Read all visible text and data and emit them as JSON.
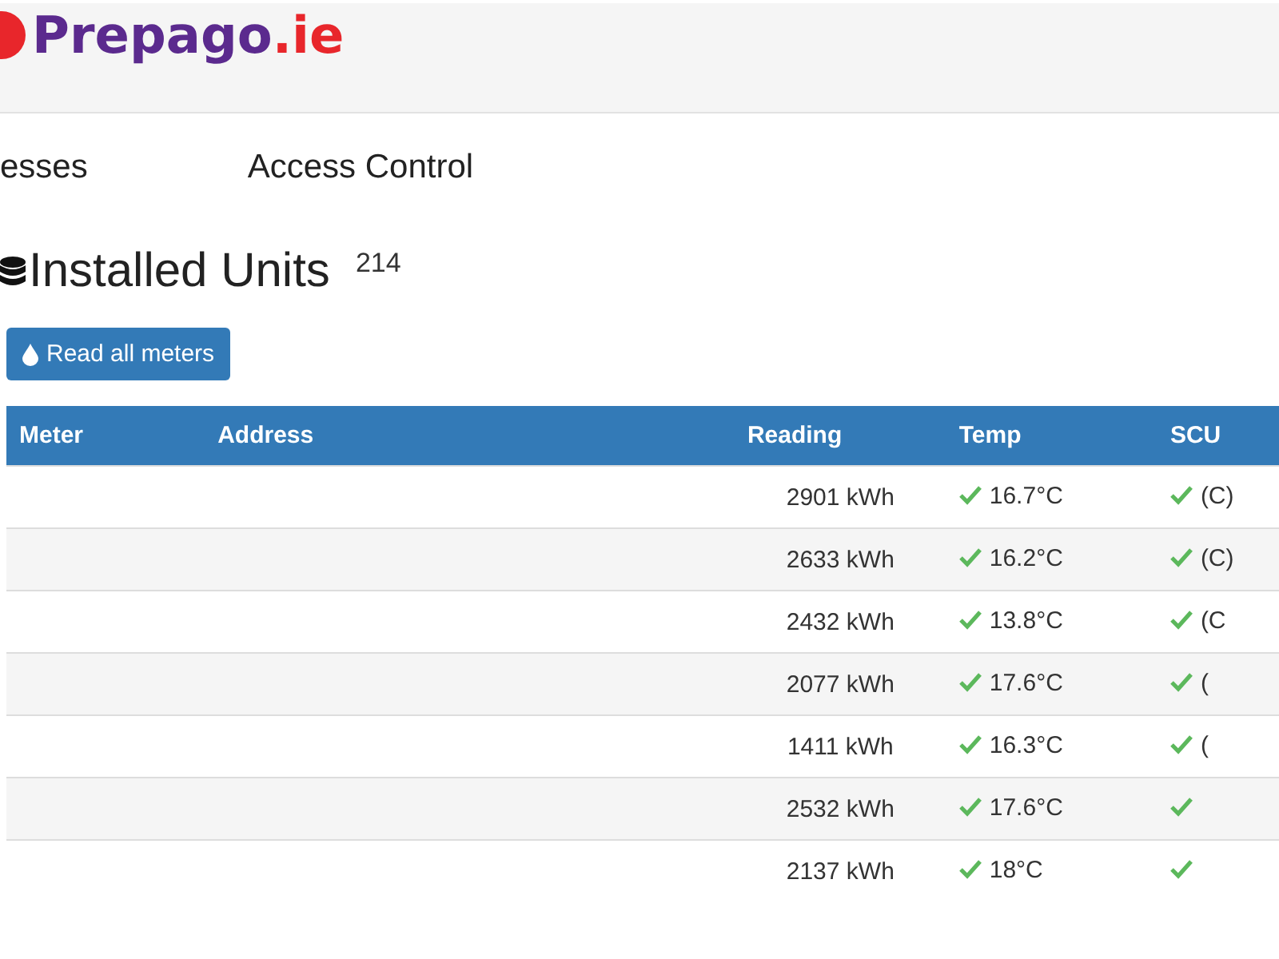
{
  "header": {
    "logo_main": "Prepago",
    "logo_suffix": ".ie"
  },
  "nav": [
    {
      "label": "esses"
    },
    {
      "label": "Access Control"
    }
  ],
  "heading": {
    "title": "Installed Units",
    "count": "214"
  },
  "read_button": "Read all meters",
  "table": {
    "columns": [
      "Meter",
      "Address",
      "Reading",
      "Temp",
      "SCU"
    ],
    "rows": [
      {
        "reading": "2901 kWh",
        "temp": "16.7°C",
        "temp_ok": true,
        "scu": "(C)",
        "scu_ok": true
      },
      {
        "reading": "2633 kWh",
        "temp": "16.2°C",
        "temp_ok": true,
        "scu": "(C)",
        "scu_ok": true
      },
      {
        "reading": "2432 kWh",
        "temp": "13.8°C",
        "temp_ok": true,
        "scu": "(C",
        "scu_ok": true
      },
      {
        "reading": "2077 kWh",
        "temp": "17.6°C",
        "temp_ok": true,
        "scu": "(",
        "scu_ok": true
      },
      {
        "reading": "1411 kWh",
        "temp": "16.3°C",
        "temp_ok": true,
        "scu": "(",
        "scu_ok": true
      },
      {
        "reading": "2532 kWh",
        "temp": "17.6°C",
        "temp_ok": true,
        "scu_ok": true
      },
      {
        "reading": "2137 kWh",
        "temp": "18°C",
        "temp_ok": true,
        "scu_ok": true
      }
    ]
  }
}
